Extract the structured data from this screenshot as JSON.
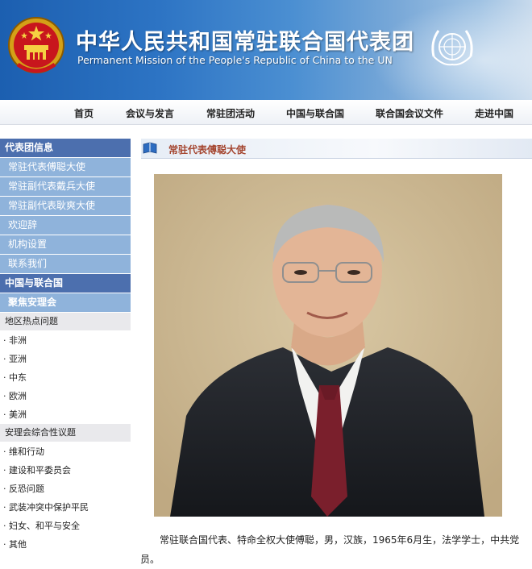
{
  "header": {
    "title_cn": "中华人民共和国常驻联合国代表团",
    "title_en": "Permanent Mission of the People's Republic of China to the UN"
  },
  "nav": [
    "首页",
    "会议与发言",
    "常驻团活动",
    "中国与联合国",
    "联合国会议文件",
    "走进中国"
  ],
  "sidebar": {
    "section1": "代表团信息",
    "section1_items": [
      "常驻代表傅聪大使",
      "常驻副代表戴兵大使",
      "常驻副代表耿爽大使",
      "欢迎辞",
      "机构设置",
      "联系我们"
    ],
    "section2": "中国与联合国",
    "focus": "聚焦安理会",
    "region_header": "地区热点问题",
    "regions": [
      "· 非洲",
      "· 亚洲",
      "· 中东",
      "· 欧洲",
      "· 美洲"
    ],
    "topic_header": "安理会综合性议题",
    "topics": [
      "· 维和行动",
      "· 建设和平委员会",
      "· 反恐问题",
      "· 武装冲突中保护平民",
      "· 妇女、和平与安全",
      "· 其他"
    ]
  },
  "main": {
    "title": "常驻代表傅聪大使",
    "paragraph": "常驻联合国代表、特命全权大使傅聪，男，汉族，1965年6月生，法学学士，中共党员。"
  },
  "colors": {
    "banner_blue": "#1c5fb0",
    "sidebar_head": "#4c6fae",
    "sidebar_sub": "#8fb3db",
    "title_accent": "#a4452f"
  }
}
